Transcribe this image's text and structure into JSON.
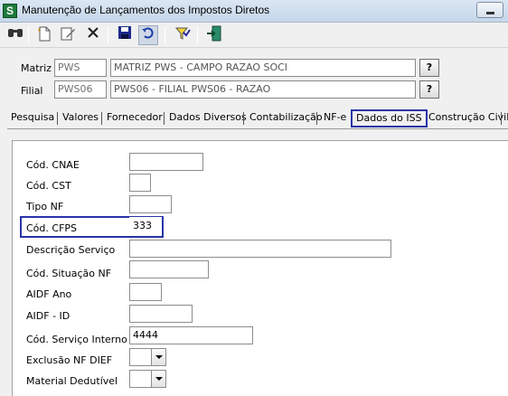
{
  "window": {
    "title": "Manutenção de Lançamentos dos Impostos Diretos"
  },
  "toolbar": {
    "icons": [
      "binoculars-icon",
      "new-document-icon",
      "edit-icon",
      "delete-icon",
      "save-icon",
      "undo-icon",
      "filter-icon",
      "exit-icon"
    ]
  },
  "header": {
    "matriz_label": "Matriz",
    "matriz_code": "PWS",
    "matriz_name": "MATRIZ PWS -  CAMPO RAZAO SOCI",
    "filial_label": "Filial",
    "filial_code": "PWS06",
    "filial_name": "PWS06 - FILIAL PWS06  - RAZAO",
    "help_label": "?"
  },
  "tabs": [
    "Pesquisa",
    "Valores",
    "Fornecedor",
    "Dados Diversos",
    "Contabilização",
    "NF-e",
    "Dados do ISS",
    "Construção Civil"
  ],
  "active_tab": "Dados do ISS",
  "form": {
    "cnae_label": "Cód. CNAE",
    "cnae_value": "",
    "cst_label": "Cód. CST",
    "cst_value": "",
    "tiponf_label": "Tipo NF",
    "tiponf_value": "",
    "cfps_label": "Cód. CFPS",
    "cfps_value": "333",
    "descricao_label": "Descrição Serviço",
    "descricao_value": "",
    "situacao_label": "Cód. Situação NF",
    "situacao_value": "",
    "aidf_ano_label": "AIDF Ano",
    "aidf_ano_value": "",
    "aidf_id_label": "AIDF - ID",
    "aidf_id_value": "",
    "servico_interno_label": "Cód. Serviço Interno",
    "servico_interno_value": "4444",
    "exclusao_label": "Exclusão NF DIEF",
    "exclusao_value": "",
    "material_label": "Material Dedutível",
    "material_value": ""
  }
}
